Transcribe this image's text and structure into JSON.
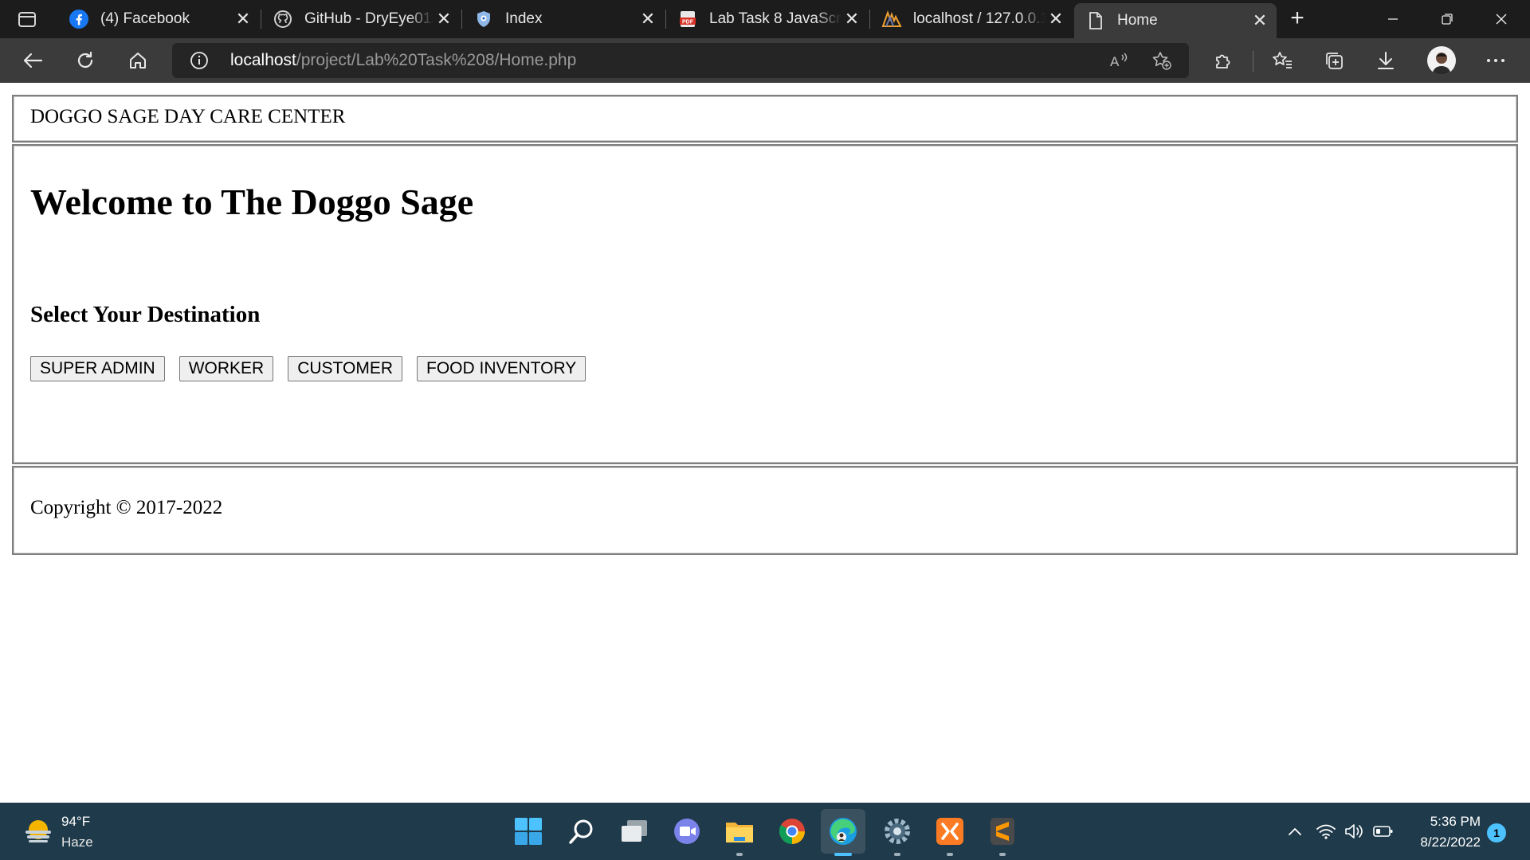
{
  "browser": {
    "tabs": [
      {
        "title": "(4) Facebook",
        "icon": "facebook-icon"
      },
      {
        "title": "GitHub - DryEye01/",
        "icon": "github-icon"
      },
      {
        "title": "Index",
        "icon": "shield-icon"
      },
      {
        "title": "Lab Task 8 JavaScrip",
        "icon": "pdf-icon"
      },
      {
        "title": "localhost / 127.0.0.1",
        "icon": "phpmyadmin-icon"
      },
      {
        "title": "Home",
        "icon": "page-icon",
        "active": true
      }
    ],
    "address": {
      "host": "localhost",
      "path": "/project/Lab%20Task%208/Home.php"
    },
    "colors": {
      "tabstrip": "#1c1c1c",
      "toolbar": "#3b3b3b",
      "omnibox": "#252525"
    }
  },
  "page": {
    "header_text": "DOGGO SAGE DAY CARE CENTER",
    "title": "Welcome to The Doggo Sage",
    "subtitle": "Select Your Destination",
    "buttons": [
      "SUPER ADMIN",
      "WORKER",
      "CUSTOMER",
      "FOOD INVENTORY"
    ],
    "footer_text": "Copyright © 2017-2022"
  },
  "taskbar": {
    "weather": {
      "temp": "94°F",
      "desc": "Haze"
    },
    "pinned": [
      "start-icon",
      "search-icon",
      "task-view-icon",
      "teams-chat-icon",
      "file-explorer-icon",
      "chrome-icon",
      "edge-icon",
      "settings-icon",
      "xampp-icon",
      "sublime-text-icon"
    ],
    "clock": {
      "time": "5:36 PM",
      "date": "8/22/2022"
    },
    "notification_count": "1",
    "color": "#1f3a4a"
  }
}
